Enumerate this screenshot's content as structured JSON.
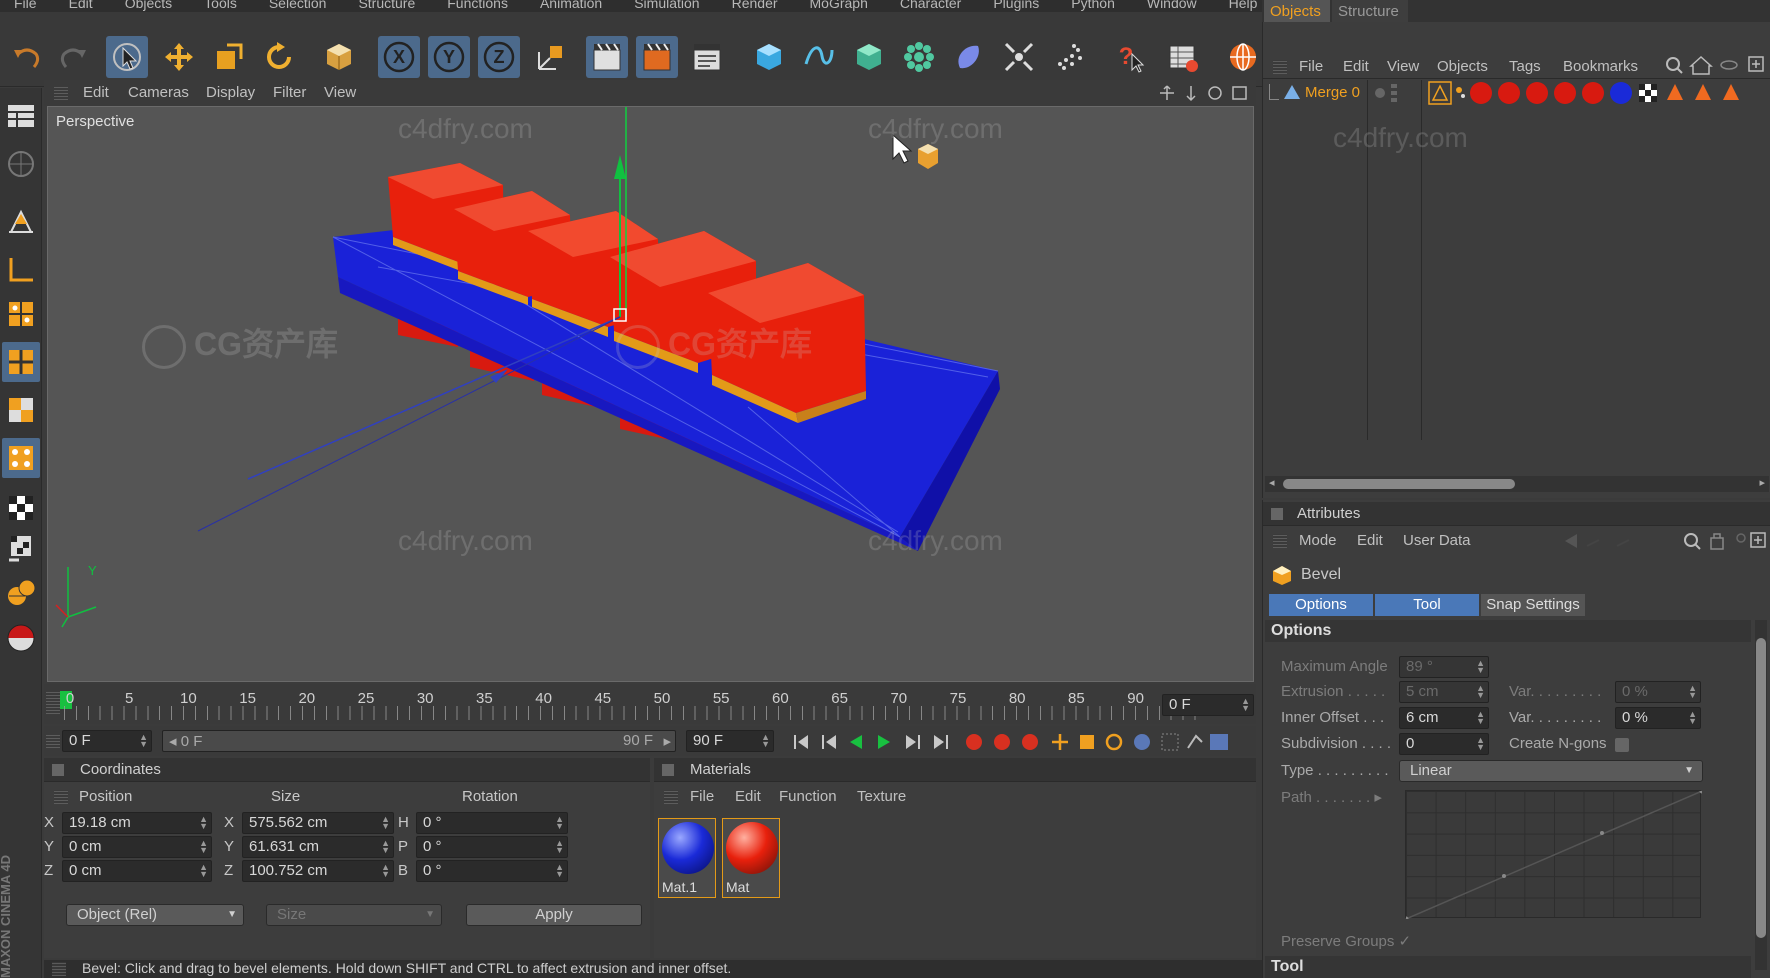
{
  "menubar": [
    "File",
    "Edit",
    "Objects",
    "Tools",
    "Selection",
    "Structure",
    "Functions",
    "Animation",
    "Simulation",
    "Render",
    "MoGraph",
    "Character",
    "Plugins",
    "Python",
    "Window",
    "Help"
  ],
  "toolbar": {
    "icons": [
      "undo-icon",
      "redo-icon",
      "live-select-icon",
      "move-icon",
      "scale-icon",
      "rotate-icon",
      "object-mode-icon",
      "x-axis-lock-icon",
      "y-axis-lock-icon",
      "z-axis-lock-icon",
      "coordinate-system-icon",
      "render-view-icon",
      "render-picture-viewer-icon",
      "render-settings-icon",
      "cube-icon",
      "spline-icon",
      "nurbs-icon",
      "array-icon",
      "deformer-icon",
      "scene-icon",
      "particle-icon",
      "help-icon",
      "content-browser-icon",
      "web-icon"
    ],
    "axis_labels": [
      "X",
      "Y",
      "Z"
    ]
  },
  "viewport": {
    "menu": [
      "Edit",
      "Cameras",
      "Display",
      "Filter",
      "View"
    ],
    "label": "Perspective",
    "watermarks": [
      "c4dfry.com",
      "c4dfry.com",
      "c4dfry.com",
      "c4dfry.com",
      "CG资产库",
      "CG资产库",
      "CG资产库",
      "CG资产库"
    ],
    "axis_y_label": "Y",
    "colors": {
      "base": "#1a1ae0",
      "cube": "#e8200c",
      "bevel": "#e39a18",
      "background": "#555555"
    }
  },
  "timeline": {
    "frame_numbers": [
      "0",
      "5",
      "10",
      "15",
      "20",
      "25",
      "30",
      "35",
      "40",
      "45",
      "50",
      "55",
      "60",
      "65",
      "70",
      "75",
      "80",
      "85",
      "90"
    ],
    "current_frame": "0 F",
    "start_field": "0 F",
    "range_start": "0 F",
    "range_end": "90 F",
    "end_field": "90 F"
  },
  "coordinates": {
    "title": "Coordinates",
    "headers": [
      "Position",
      "Size",
      "Rotation"
    ],
    "rows": [
      {
        "axis": "X",
        "position": "19.18 cm",
        "size_axis": "X",
        "size": "575.562 cm",
        "rot_axis": "H",
        "rotation": "0 °"
      },
      {
        "axis": "Y",
        "position": "0 cm",
        "size_axis": "Y",
        "size": "61.631 cm",
        "rot_axis": "P",
        "rotation": "0 °"
      },
      {
        "axis": "Z",
        "position": "0 cm",
        "size_axis": "Z",
        "size": "100.752 cm",
        "rot_axis": "B",
        "rotation": "0 °"
      }
    ],
    "mode_select": "Object (Rel)",
    "size_select": "Size",
    "apply_label": "Apply"
  },
  "materials": {
    "title": "Materials",
    "menu": [
      "File",
      "Edit",
      "Function",
      "Texture"
    ],
    "items": [
      {
        "name": "Mat.1",
        "color": "#1a2ad8"
      },
      {
        "name": "Mat",
        "color": "#e8200c"
      }
    ]
  },
  "objects": {
    "tabs": [
      "Objects",
      "Structure"
    ],
    "menu": [
      "File",
      "Edit",
      "View",
      "Objects",
      "Tags",
      "Bookmarks"
    ],
    "object_name": "Merge 0",
    "watermark": "c4dfry.com"
  },
  "attributes": {
    "title": "Attributes",
    "menu": [
      "Mode",
      "Edit",
      "User Data"
    ],
    "tool_name": "Bevel",
    "tabs": [
      "Options",
      "Tool",
      "Snap Settings"
    ],
    "section": "Options",
    "fields": {
      "max_angle_label": "Maximum Angle",
      "max_angle": "89 °",
      "extrusion_label": "Extrusion",
      "extrusion": "5 cm",
      "var_label": "Var.",
      "var1": "0 %",
      "inner_offset_label": "Inner Offset",
      "inner_offset": "6 cm",
      "var2": "0 %",
      "subdivision_label": "Subdivision",
      "subdivision": "0",
      "ngons_label": "Create N-gons",
      "type_label": "Type",
      "type": "Linear",
      "path_label": "Path",
      "preserve_label": "Preserve Groups",
      "tool_section": "Tool"
    }
  },
  "side_brand": "MAXON CINEMA 4D",
  "status": "Bevel: Click and drag to bevel elements. Hold down SHIFT and CTRL to affect extrusion and inner offset."
}
